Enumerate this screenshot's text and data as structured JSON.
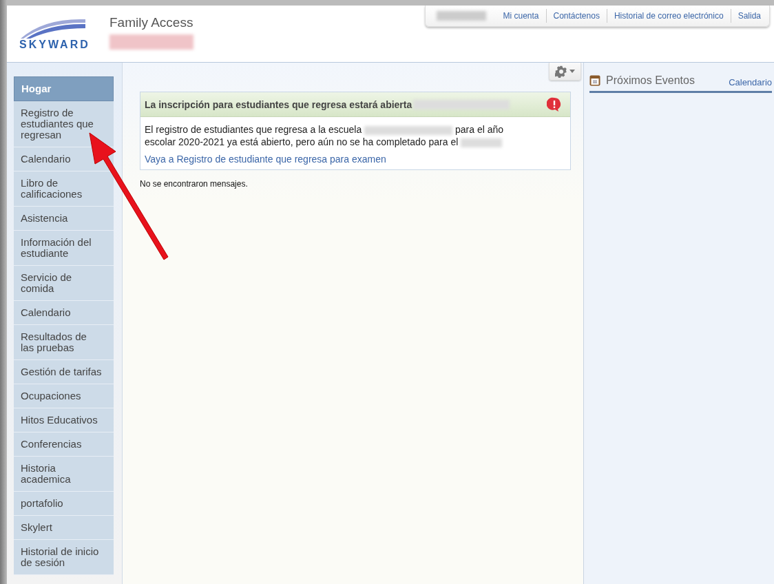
{
  "header": {
    "logo_text": "SKYWARD",
    "app_title": "Family Access"
  },
  "top_links": [
    "Mi cuenta",
    "Contáctenos",
    "Historial de correo electrónico",
    "Salida"
  ],
  "sidebar": {
    "items": [
      {
        "label": "Hogar",
        "selected": true
      },
      {
        "label": "Registro de estudiantes que regresan",
        "selected": false
      },
      {
        "label": "Calendario",
        "selected": false
      },
      {
        "label": "Libro de calificaciones",
        "selected": false
      },
      {
        "label": "Asistencia",
        "selected": false
      },
      {
        "label": "Información del estudiante",
        "selected": false
      },
      {
        "label": "Servicio de comida",
        "selected": false
      },
      {
        "label": "Calendario",
        "selected": false
      },
      {
        "label": "Resultados de las pruebas",
        "selected": false
      },
      {
        "label": "Gestión de tarifas",
        "selected": false
      },
      {
        "label": "Ocupaciones",
        "selected": false
      },
      {
        "label": "Hitos Educativos",
        "selected": false
      },
      {
        "label": "Conferencias",
        "selected": false
      },
      {
        "label": "Historia academica",
        "selected": false
      },
      {
        "label": "portafolio",
        "selected": false
      },
      {
        "label": "Skylert",
        "selected": false
      },
      {
        "label": "Historial de inicio de sesión",
        "selected": false
      }
    ]
  },
  "announcement": {
    "title": "La inscripción para estudiantes que regresa estará abierta",
    "body_start": "El registro de estudiantes que regresa a la escuela",
    "body_end": "para el año escolar 2020-2021 ya está abierto, pero aún no se ha completado para el",
    "link": "Vaya a Registro de estudiante que regresa para examen"
  },
  "messages_status": "No se encontraron mensajes.",
  "events_panel": {
    "title": "Próximos Eventos",
    "calendar_link": "Calendario"
  }
}
